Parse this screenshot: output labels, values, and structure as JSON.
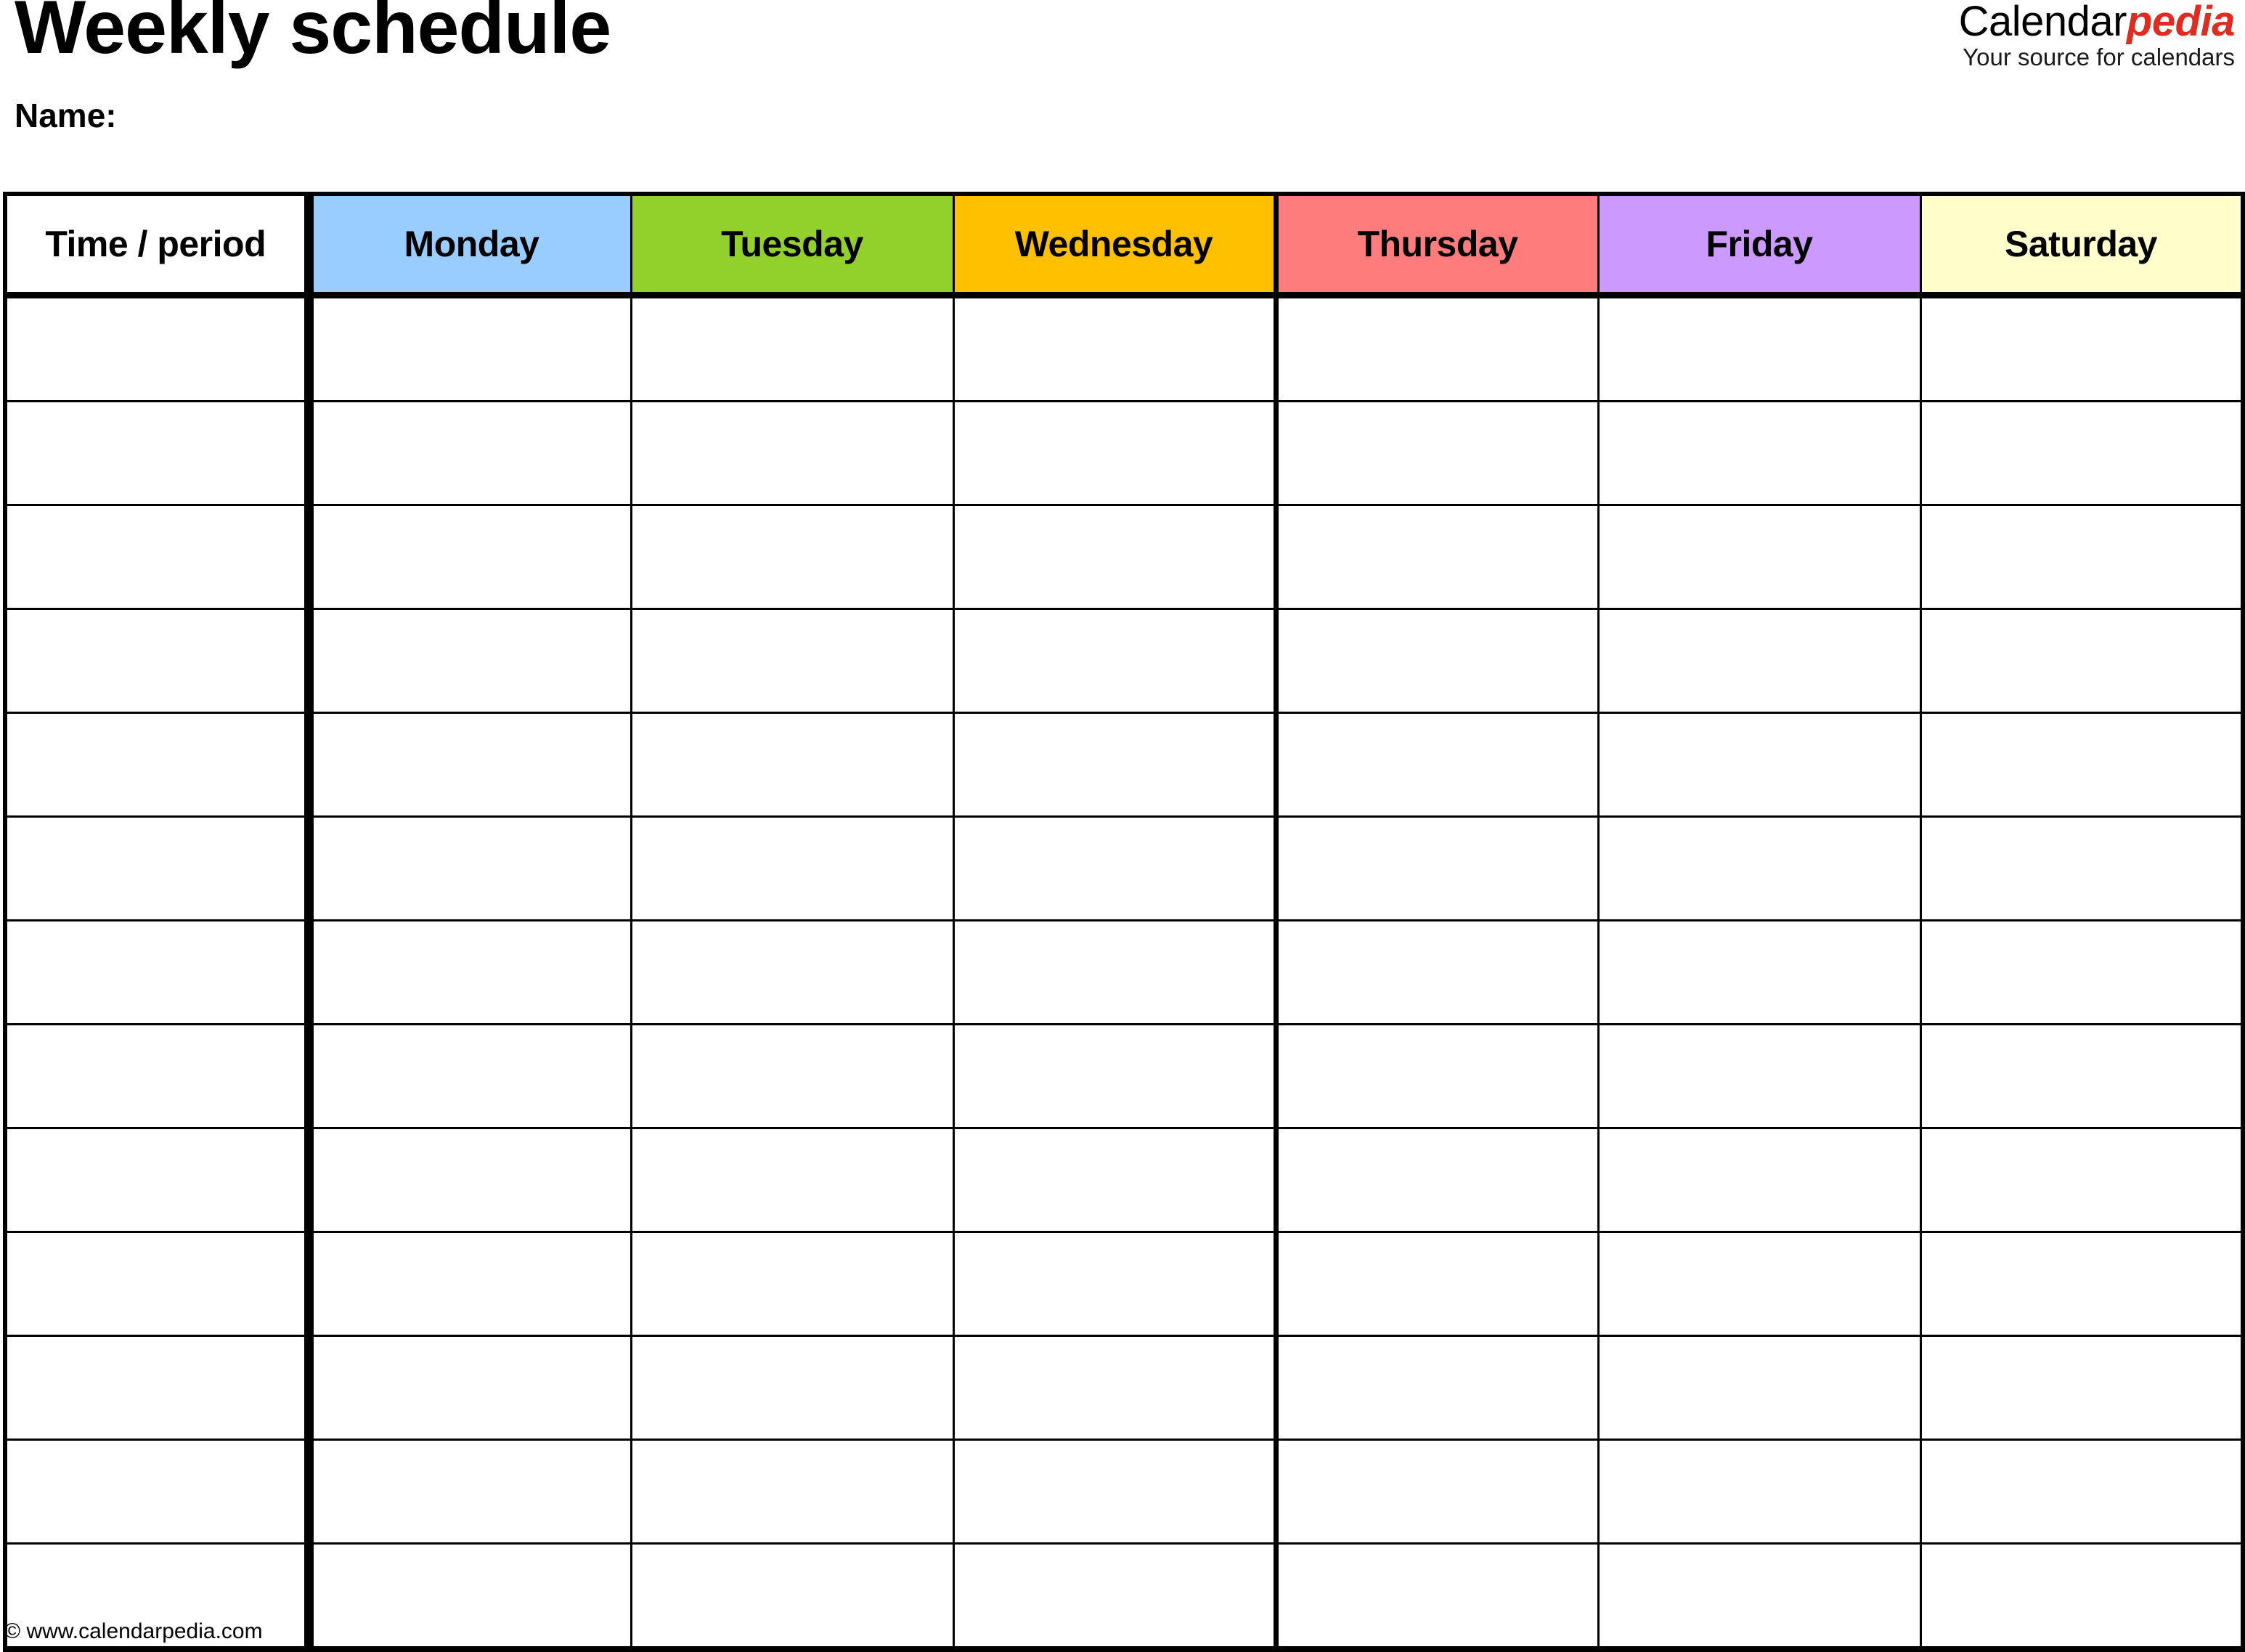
{
  "document": {
    "title": "Weekly schedule",
    "name_label": "Name:"
  },
  "brand": {
    "name_part1": "Calendar",
    "name_part2": "pedia",
    "tagline": "Your source for calendars",
    "accent_color": "#e02b20"
  },
  "table": {
    "columns": [
      {
        "key": "time",
        "label": "Time / period",
        "header_color": "#ffffff"
      },
      {
        "key": "monday",
        "label": "Monday",
        "header_color": "#99ccff"
      },
      {
        "key": "tuesday",
        "label": "Tuesday",
        "header_color": "#92d02b"
      },
      {
        "key": "wednesday",
        "label": "Wednesday",
        "header_color": "#ffc000"
      },
      {
        "key": "thursday",
        "label": "Thursday",
        "header_color": "#ff7c7c"
      },
      {
        "key": "friday",
        "label": "Friday",
        "header_color": "#cc99ff"
      },
      {
        "key": "saturday",
        "label": "Saturday",
        "header_color": "#ffffcc"
      }
    ],
    "row_count": 13,
    "rows": [
      [
        "",
        "",
        "",
        "",
        "",
        "",
        ""
      ],
      [
        "",
        "",
        "",
        "",
        "",
        "",
        ""
      ],
      [
        "",
        "",
        "",
        "",
        "",
        "",
        ""
      ],
      [
        "",
        "",
        "",
        "",
        "",
        "",
        ""
      ],
      [
        "",
        "",
        "",
        "",
        "",
        "",
        ""
      ],
      [
        "",
        "",
        "",
        "",
        "",
        "",
        ""
      ],
      [
        "",
        "",
        "",
        "",
        "",
        "",
        ""
      ],
      [
        "",
        "",
        "",
        "",
        "",
        "",
        ""
      ],
      [
        "",
        "",
        "",
        "",
        "",
        "",
        ""
      ],
      [
        "",
        "",
        "",
        "",
        "",
        "",
        ""
      ],
      [
        "",
        "",
        "",
        "",
        "",
        "",
        ""
      ],
      [
        "",
        "",
        "",
        "",
        "",
        "",
        ""
      ],
      [
        "",
        "",
        "",
        "",
        "",
        "",
        ""
      ]
    ]
  },
  "footer": {
    "copyright": "© www.calendarpedia.com"
  }
}
